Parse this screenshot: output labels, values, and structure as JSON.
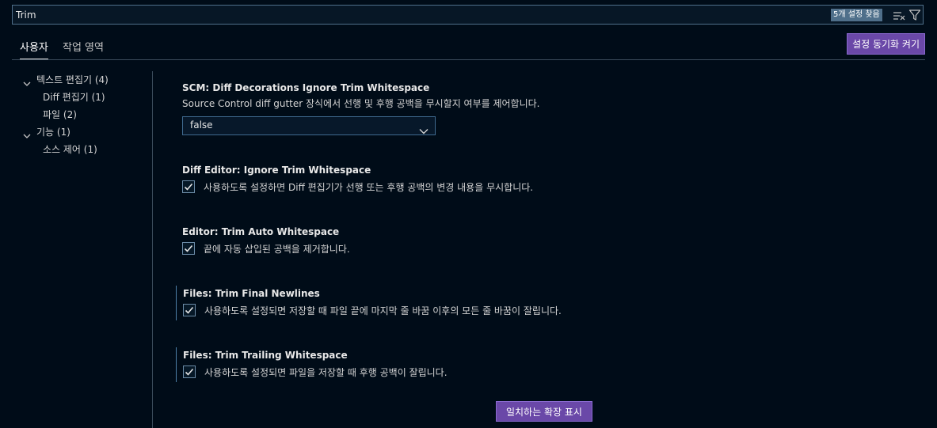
{
  "search": {
    "value": "Trim",
    "result_count": "5개 설정 찾음"
  },
  "icons": {
    "clear": "clear-filter-icon",
    "filter": "filter-icon",
    "chevron": "chevron-down-icon",
    "check": "check-icon"
  },
  "tabs": [
    {
      "label": "사용자",
      "active": true
    },
    {
      "label": "작업 영역",
      "active": false
    }
  ],
  "sync_button": "설정 동기화 켜기",
  "toc": [
    {
      "label": "텍스트 편집기 (4)",
      "level": 0,
      "expanded": true
    },
    {
      "label": "Diff 편집기 (1)",
      "level": 1
    },
    {
      "label": "파일 (2)",
      "level": 1
    },
    {
      "label": "기능 (1)",
      "level": 0,
      "expanded": true
    },
    {
      "label": "소스 제어 (1)",
      "level": 1
    }
  ],
  "settings": [
    {
      "category": "SCM: ",
      "name": "Diff Decorations Ignore Trim Whitespace",
      "description": "Source Control diff gutter 장식에서 선행 및 후행 공백을 무시할지 여부를 제어합니다.",
      "type": "select",
      "value": "false",
      "modified": false
    },
    {
      "category": "Diff Editor: ",
      "name": "Ignore Trim Whitespace",
      "description": "사용하도록 설정하면 Diff 편집기가 선행 또는 후행 공백의 변경 내용을 무시합니다.",
      "type": "checkbox",
      "checked": true,
      "modified": false
    },
    {
      "category": "Editor: ",
      "name": "Trim Auto Whitespace",
      "description": "끝에 자동 삽입된 공백을 제거합니다.",
      "type": "checkbox",
      "checked": true,
      "modified": false
    },
    {
      "category": "Files: ",
      "name": "Trim Final Newlines",
      "description": "사용하도록 설정되면 저장할 때 파일 끝에 마지막 줄 바꿈 이후의 모든 줄 바꿈이 잘립니다.",
      "type": "checkbox",
      "checked": true,
      "modified": true
    },
    {
      "category": "Files: ",
      "name": "Trim Trailing Whitespace",
      "description": "사용하도록 설정되면 파일을 저장할 때 후행 공백이 잘립니다.",
      "type": "checkbox",
      "checked": true,
      "modified": true
    }
  ],
  "extensions_button": "일치하는 확장 표시",
  "colors": {
    "background": "#000c18",
    "accent_button": "#6a48a8",
    "modified_indicator": "#4d7fa8"
  }
}
